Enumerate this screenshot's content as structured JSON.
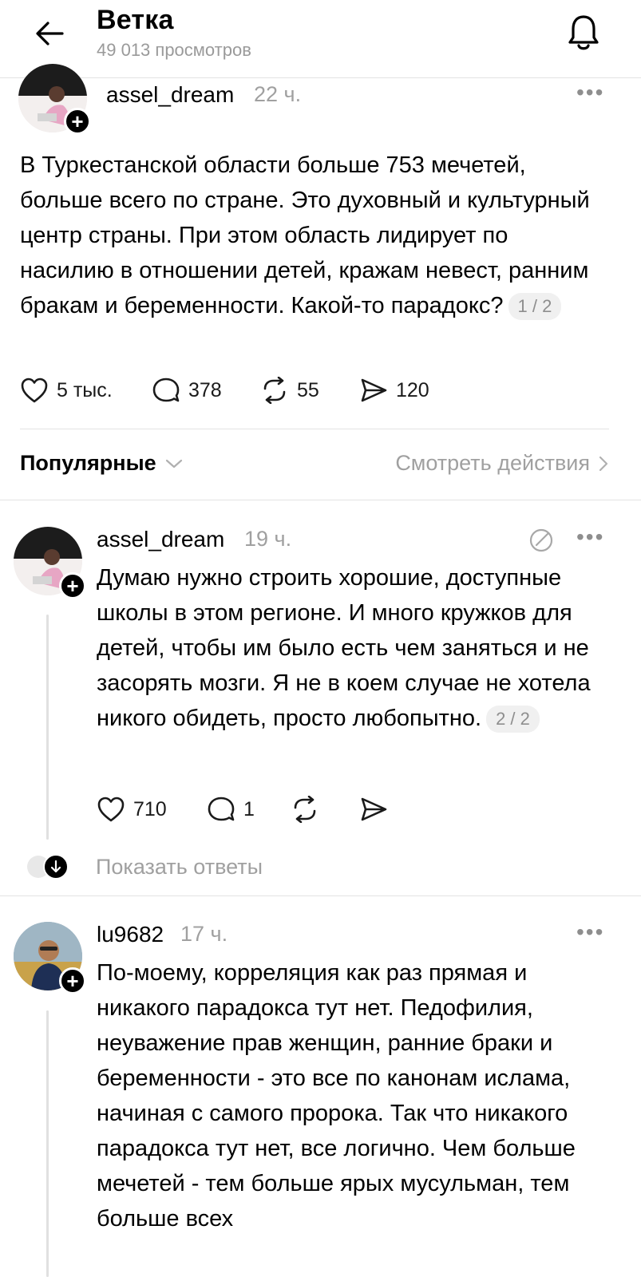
{
  "header": {
    "title": "Ветка",
    "views": "49 013 просмотров"
  },
  "post": {
    "username": "assel_dream",
    "time": "22 ч.",
    "text": "В Туркестанской области больше 753 мечетей, больше всего по стране. Это духовный и культурный центр страны. При этом область лидирует по насилию в отношении детей, кражам невест, ранним бракам и беременности. Какой-то парадокс?",
    "pager": "1 / 2",
    "likes": "5 тыс.",
    "comments": "378",
    "reposts": "55",
    "shares": "120"
  },
  "sort_bar": {
    "sort_label": "Популярные",
    "activity_link": "Смотреть действия"
  },
  "replies": [
    {
      "username": "assel_dream",
      "time": "19 ч.",
      "text": "Думаю нужно строить хорошие, доступные школы в этом регионе. И много кружков для детей, чтобы им было есть чем заняться и не засорять мозги. Я не в коем случае не хотела никого обидеть, просто любопытно.",
      "pager": "2 / 2",
      "likes": "710",
      "comments": "1",
      "show_replies": "Показать ответы"
    },
    {
      "username": "lu9682",
      "time": "17 ч.",
      "text": "По-моему, корреляция как раз прямая и никакого парадокса тут нет. Педофилия, неуважение прав женщин, ранние браки и беременности - это все по канонам ислама, начиная с самого пророка. Так что никакого парадокса тут нет, все логично. Чем больше мечетей - тем больше ярых мусульман, тем больше всех"
    }
  ],
  "icons": {
    "back": "arrow-left-icon",
    "bell": "bell-icon",
    "like": "heart-icon",
    "comment": "comment-bubble-icon",
    "repost": "repost-icon",
    "share": "send-icon",
    "more": "more-dots-icon",
    "add": "plus-icon",
    "chevron": "chevron-icon",
    "edited": "edited-icon",
    "arrow_down": "arrow-down-icon"
  }
}
